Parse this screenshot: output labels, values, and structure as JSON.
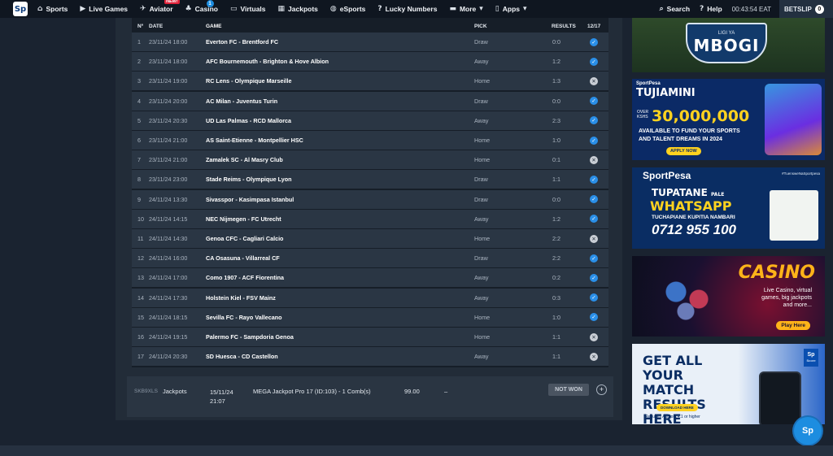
{
  "logo": "Sp",
  "nav": {
    "items": [
      {
        "label": "Sports",
        "icon": "home-icon",
        "glyph": "⌂"
      },
      {
        "label": "Live Games",
        "icon": "play-icon",
        "glyph": "▶"
      },
      {
        "label": "Aviator",
        "icon": "plane-icon",
        "glyph": "✈",
        "badge": "NEW!"
      },
      {
        "label": "Casino",
        "icon": "casino-icon",
        "glyph": "♣",
        "count": "1"
      },
      {
        "label": "Virtuals",
        "icon": "monitor-icon",
        "glyph": "▭"
      },
      {
        "label": "Jackpots",
        "icon": "jackpot-icon",
        "glyph": "▦"
      },
      {
        "label": "eSports",
        "icon": "gamepad-icon",
        "glyph": "◍"
      },
      {
        "label": "Lucky Numbers",
        "icon": "lucky-icon",
        "glyph": "?"
      },
      {
        "label": "More",
        "icon": "more-icon",
        "glyph": "▬"
      },
      {
        "label": "Apps",
        "icon": "phone-icon",
        "glyph": "▯"
      }
    ],
    "search": "Search",
    "help": "Help",
    "clock": "00:43:54 EAT",
    "betslip_label": "BETSLIP",
    "betslip_count": "0"
  },
  "table": {
    "headers": {
      "no": "Nº",
      "date": "DATE",
      "game": "GAME",
      "pick": "PICK",
      "results": "RESULTS",
      "score": "12/17"
    },
    "rows": [
      {
        "no": "1",
        "date": "23/11/24 18:00",
        "game": "Everton FC - Brentford FC",
        "pick": "Draw",
        "result": "0:0",
        "status": "won"
      },
      {
        "no": "2",
        "date": "23/11/24 18:00",
        "game": "AFC Bournemouth - Brighton & Hove Albion",
        "pick": "Away",
        "result": "1:2",
        "status": "won"
      },
      {
        "no": "3",
        "date": "23/11/24 19:00",
        "game": "RC Lens - Olympique Marseille",
        "pick": "Home",
        "result": "1:3",
        "status": "lost"
      },
      {
        "no": "4",
        "date": "23/11/24 20:00",
        "game": "AC Milan - Juventus Turin",
        "pick": "Draw",
        "result": "0:0",
        "status": "won"
      },
      {
        "no": "5",
        "date": "23/11/24 20:30",
        "game": "UD Las Palmas - RCD Mallorca",
        "pick": "Away",
        "result": "2:3",
        "status": "won"
      },
      {
        "no": "6",
        "date": "23/11/24 21:00",
        "game": "AS Saint-Etienne - Montpellier HSC",
        "pick": "Home",
        "result": "1:0",
        "status": "won"
      },
      {
        "no": "7",
        "date": "23/11/24 21:00",
        "game": "Zamalek SC - Al Masry Club",
        "pick": "Home",
        "result": "0:1",
        "status": "lost"
      },
      {
        "no": "8",
        "date": "23/11/24 23:00",
        "game": "Stade Reims - Olympique Lyon",
        "pick": "Draw",
        "result": "1:1",
        "status": "won"
      },
      {
        "no": "9",
        "date": "24/11/24 13:30",
        "game": "Sivasspor - Kasimpasa Istanbul",
        "pick": "Draw",
        "result": "0:0",
        "status": "won"
      },
      {
        "no": "10",
        "date": "24/11/24 14:15",
        "game": "NEC Nijmegen - FC Utrecht",
        "pick": "Away",
        "result": "1:2",
        "status": "won"
      },
      {
        "no": "11",
        "date": "24/11/24 14:30",
        "game": "Genoa CFC - Cagliari Calcio",
        "pick": "Home",
        "result": "2:2",
        "status": "lost"
      },
      {
        "no": "12",
        "date": "24/11/24 16:00",
        "game": "CA Osasuna - Villarreal CF",
        "pick": "Draw",
        "result": "2:2",
        "status": "won"
      },
      {
        "no": "13",
        "date": "24/11/24 17:00",
        "game": "Como 1907 - ACF Fiorentina",
        "pick": "Away",
        "result": "0:2",
        "status": "won"
      },
      {
        "no": "14",
        "date": "24/11/24 17:30",
        "game": "Holstein Kiel - FSV Mainz",
        "pick": "Away",
        "result": "0:3",
        "status": "won"
      },
      {
        "no": "15",
        "date": "24/11/24 18:15",
        "game": "Sevilla FC - Rayo Vallecano",
        "pick": "Home",
        "result": "1:0",
        "status": "won"
      },
      {
        "no": "16",
        "date": "24/11/24 19:15",
        "game": "Palermo FC - Sampdoria Genoa",
        "pick": "Home",
        "result": "1:1",
        "status": "lost"
      },
      {
        "no": "17",
        "date": "24/11/24 20:30",
        "game": "SD Huesca - CD Castellon",
        "pick": "Away",
        "result": "1:1",
        "status": "lost"
      }
    ]
  },
  "bet": {
    "id": "SKB9XLS",
    "type": "Jackpots",
    "date_line1": "15/11/24",
    "date_line2": "21:07",
    "description": "MEGA Jackpot Pro 17 (ID:103) - 1 Comb(s)",
    "stake": "99.00",
    "winnings": "–",
    "status": "NOT WON",
    "expand": "+"
  },
  "banners": {
    "b1": {
      "small": "LIGI YA",
      "big": "MBOGI"
    },
    "b2": {
      "brand": "SportPesa",
      "title": "TUJIAMINI",
      "over": "OVER KSHS",
      "amount": "30,000,000",
      "line1": "AVAILABLE TO FUND YOUR SPORTS",
      "line2": "AND TALENT DREAMS IN 2024",
      "cta": "APPLY NOW"
    },
    "b3": {
      "brand": "SportPesa",
      "hash": "#TuensweNaSportpesa",
      "t1a": "TUPATANE",
      "t1b": "PALE",
      "t2": "WHATSAPP",
      "t3": "TUCHAPIANE KUPITIA NAMBARI",
      "t4": "0712 955 100"
    },
    "b4": {
      "title": "CASINO",
      "line1": "Live Casino, virtual",
      "line2": "games, big jackpots",
      "line3": "and more...",
      "cta": "Play Here"
    },
    "b5": {
      "title": "GET ALL YOUR MATCH RESULTS HERE",
      "download": "DOWNLOAD HERE",
      "req": "Requires Android 4.1 or higher",
      "sp": "Sp",
      "sp_sub": "Score"
    }
  },
  "chat_label": "Sp",
  "colors": {
    "won": "#2a8fe8",
    "lost": "#c9ced5",
    "accent": "#1d8de0"
  }
}
